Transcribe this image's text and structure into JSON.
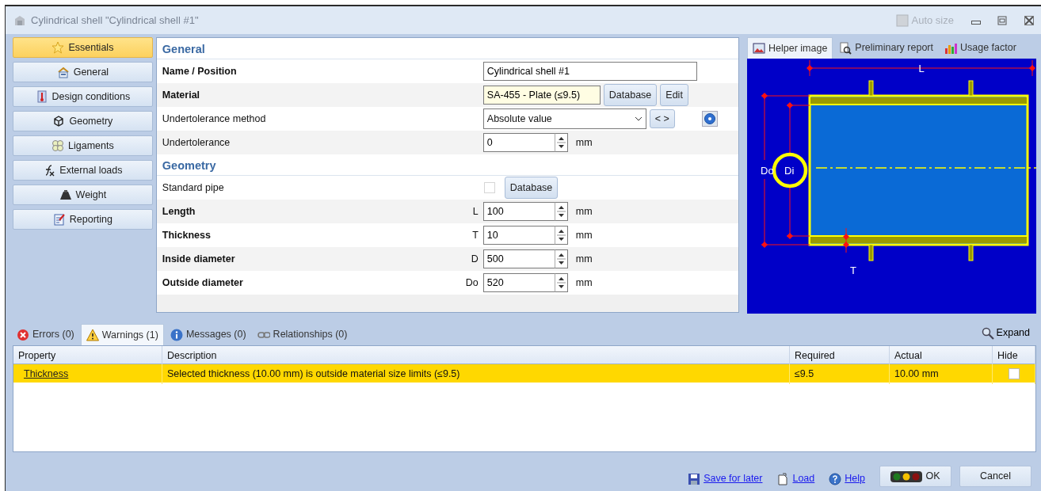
{
  "window": {
    "title": "Cylindrical shell \"Cylindrical shell #1\"",
    "auto_size": {
      "label": "Auto size",
      "disabled": true
    }
  },
  "sidebar": {
    "items": [
      {
        "label": "Essentials",
        "selected": true
      },
      {
        "label": "General",
        "selected": false
      },
      {
        "label": "Design conditions",
        "selected": false
      },
      {
        "label": "Geometry",
        "selected": false
      },
      {
        "label": "Ligaments",
        "selected": false
      },
      {
        "label": "External loads",
        "selected": false
      },
      {
        "label": "Weight",
        "selected": false
      },
      {
        "label": "Reporting",
        "selected": false
      }
    ]
  },
  "form": {
    "sections": [
      {
        "title": "General",
        "rows": [
          {
            "kind": "text",
            "label": "Name / Position",
            "bold": true,
            "value": "Cylindrical shell #1"
          },
          {
            "kind": "material",
            "label": "Material",
            "bold": true,
            "value": "SA-455 - Plate (≤9.5)",
            "buttons": [
              "Database",
              "Edit"
            ]
          },
          {
            "kind": "select",
            "label": "Undertolerance method",
            "bold": false,
            "value": "Absolute value",
            "nav_button": "< >"
          },
          {
            "kind": "spin",
            "label": "Undertolerance",
            "bold": false,
            "value": "0",
            "unit": "mm"
          }
        ]
      },
      {
        "title": "Geometry",
        "rows": [
          {
            "kind": "checkbox",
            "label": "Standard pipe",
            "bold": false,
            "checked": false,
            "disabled": true,
            "buttons": [
              "Database"
            ]
          },
          {
            "kind": "spin",
            "label": "Length",
            "bold": true,
            "symbol": "L",
            "value": "100",
            "unit": "mm"
          },
          {
            "kind": "spin",
            "label": "Thickness",
            "bold": true,
            "symbol": "T",
            "value": "10",
            "unit": "mm"
          },
          {
            "kind": "spin",
            "label": "Inside diameter",
            "bold": true,
            "symbol": "D",
            "value": "500",
            "unit": "mm"
          },
          {
            "kind": "spin",
            "label": "Outside diameter",
            "bold": true,
            "symbol": "Do",
            "value": "520",
            "unit": "mm"
          }
        ]
      }
    ]
  },
  "helper": {
    "tabs": [
      {
        "label": "Helper image",
        "selected": true
      },
      {
        "label": "Preliminary report",
        "selected": false
      },
      {
        "label": "Usage factor",
        "selected": false
      }
    ],
    "diagram_labels": {
      "length": "L",
      "outside_diameter": "Do",
      "inside_diameter": "Di",
      "thickness": "T"
    }
  },
  "messages": {
    "tabs": [
      {
        "kind": "error",
        "label": "Errors (0)",
        "selected": false
      },
      {
        "kind": "warning",
        "label": "Warnings (1)",
        "selected": true
      },
      {
        "kind": "info",
        "label": "Messages (0)",
        "selected": false
      },
      {
        "kind": "link",
        "label": "Relationships (0)",
        "selected": false
      }
    ],
    "expand": "Expand",
    "table": {
      "columns": [
        "Property",
        "Description",
        "Required",
        "Actual",
        "Hide"
      ],
      "rows": [
        {
          "property": "Thickness",
          "description": "Selected thickness (10.00 mm) is outside material size limits (≤9.5)",
          "required": "≤9.5",
          "actual": "10.00 mm",
          "hide": false,
          "selected": true
        }
      ]
    }
  },
  "footer": {
    "links": [
      {
        "kind": "save",
        "label": "Save for later"
      },
      {
        "kind": "load",
        "label": "Load"
      },
      {
        "kind": "help",
        "label": "Help"
      }
    ],
    "buttons": [
      {
        "kind": "ok",
        "label": "OK"
      },
      {
        "kind": "cancel",
        "label": "Cancel"
      }
    ]
  }
}
